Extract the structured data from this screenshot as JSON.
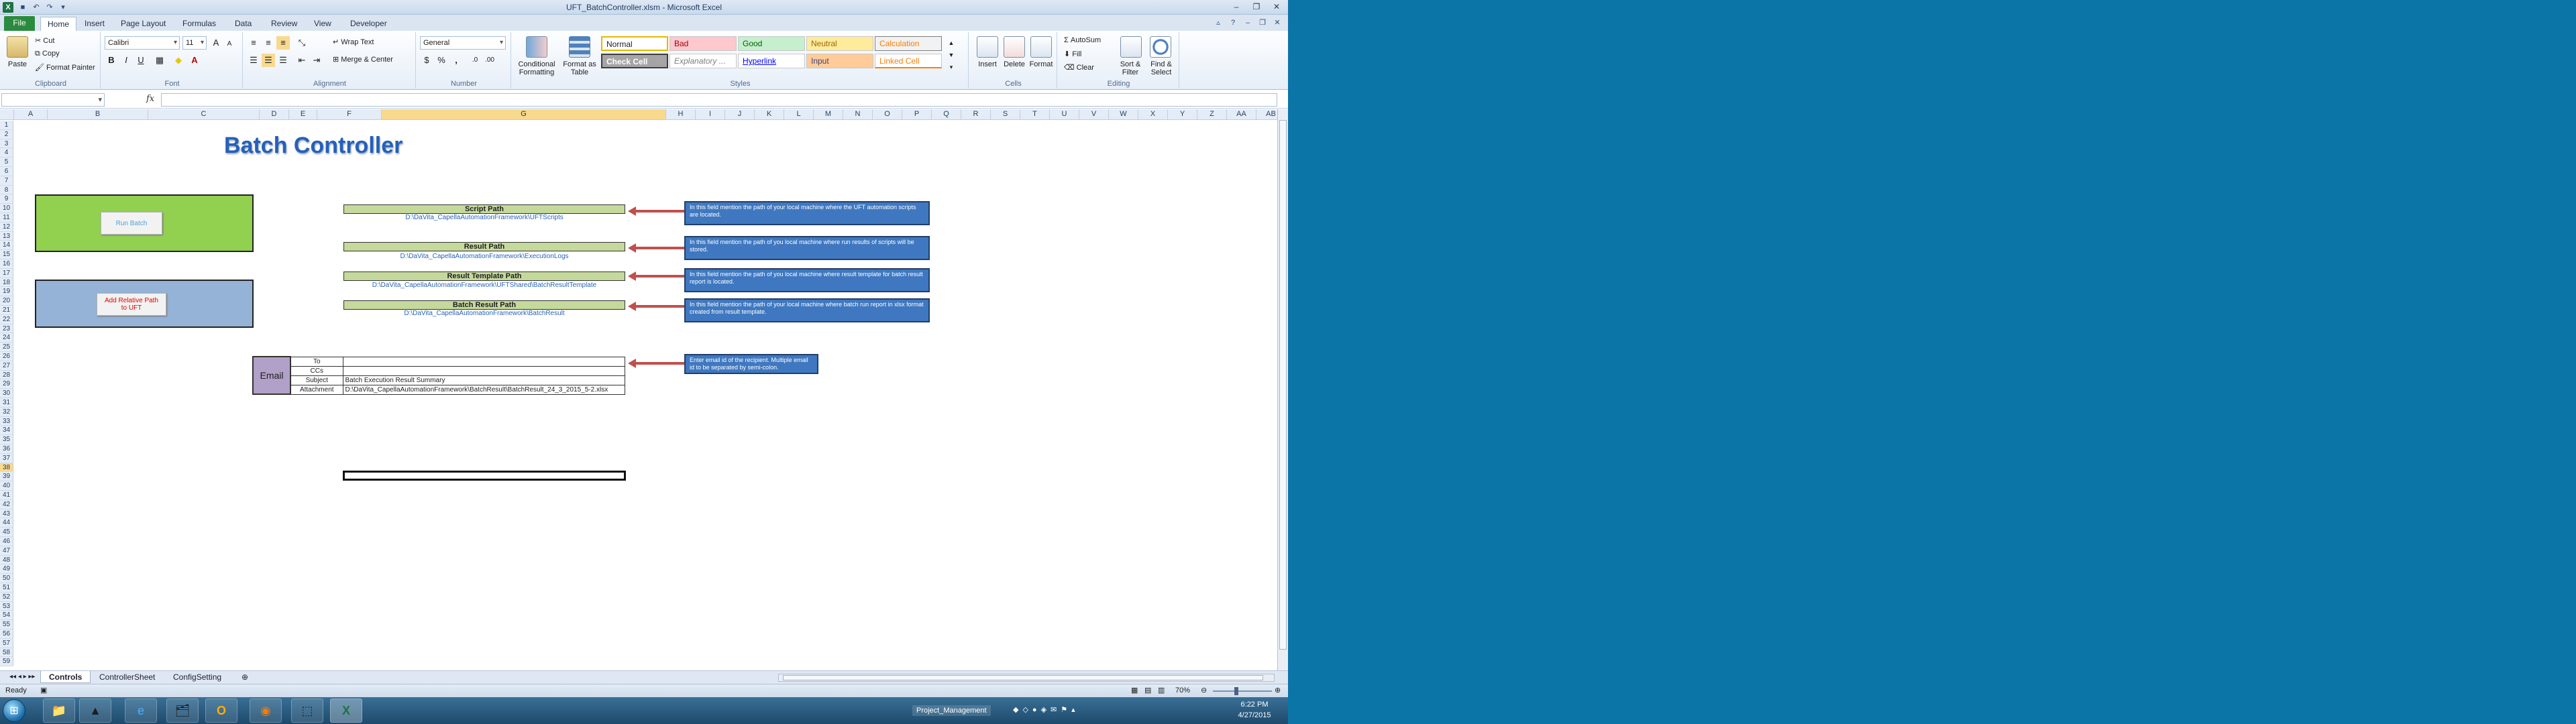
{
  "window": {
    "title": "UFT_BatchController.xlsm - Microsoft Excel"
  },
  "tabs": [
    "File",
    "Home",
    "Insert",
    "Page Layout",
    "Formulas",
    "Data",
    "Review",
    "View",
    "Developer"
  ],
  "ribbon": {
    "clipboard": {
      "name": "Clipboard",
      "paste": "Paste",
      "cut": "Cut",
      "copy": "Copy",
      "format_painter": "Format Painter"
    },
    "font": {
      "name": "Font",
      "family": "Calibri",
      "size": "11",
      "bold": "B",
      "italic": "I",
      "underline": "U"
    },
    "alignment": {
      "name": "Alignment",
      "wrap_text": "Wrap Text",
      "merge_center": "Merge & Center"
    },
    "number": {
      "name": "Number",
      "format": "General",
      "currency": "$",
      "percent": "%",
      "comma": ","
    },
    "styles": {
      "name": "Styles",
      "conditional_formatting": "Conditional Formatting",
      "format_as_table": "Format as Table",
      "cells": [
        "Normal",
        "Bad",
        "Good",
        "Neutral",
        "Calculation",
        "Check Cell",
        "Explanatory ...",
        "Hyperlink",
        "Input",
        "Linked Cell"
      ]
    },
    "cells": {
      "name": "Cells",
      "insert": "Insert",
      "delete": "Delete",
      "format": "Format"
    },
    "editing": {
      "name": "Editing",
      "autosum": "AutoSum",
      "fill": "Fill",
      "clear": "Clear",
      "sort_filter": "Sort & Filter",
      "find_select": "Find & Select"
    }
  },
  "formula_bar": {
    "namebox": "",
    "fx": "fx",
    "content": ""
  },
  "columns": [
    "A",
    "B",
    "C",
    "D",
    "E",
    "F",
    "G",
    "H",
    "I",
    "J",
    "K",
    "L",
    "M",
    "N",
    "O",
    "P",
    "Q",
    "R",
    "S",
    "T",
    "U",
    "V",
    "W",
    "X",
    "Y",
    "Z",
    "AA",
    "AB",
    "AC"
  ],
  "selected_column": "G",
  "selected_row": "38",
  "sheet": {
    "title": "Batch Controller",
    "run_batch": "Run Batch",
    "add_relative_path": "Add Relative Path to UFT",
    "paths": [
      {
        "label": "Script Path",
        "value": "D:\\DaVita_CapellaAutomationFramework\\UFTScripts",
        "note": "In this field mention the path of your local machine where the UFT automation scripts are located."
      },
      {
        "label": "Result Path",
        "value": "D:\\DaVita_CapellaAutomationFramework\\ExecutionLogs",
        "note": "In this field mention the path of you local machine where run results of scripts will be stored."
      },
      {
        "label": "Result Template Path",
        "value": "D:\\DaVita_CapellaAutomationFramework\\UFTShared\\BatchResultTemplate",
        "note": "In this field mention the path of you local machine where result template for batch result report is located."
      },
      {
        "label": "Batch Result Path",
        "value": "D:\\DaVita_CapellaAutomationFramework\\BatchResult",
        "note": "In this field mention the path of your local machine where batch run report in xlsx format created from result template."
      }
    ],
    "email": {
      "label": "Email",
      "rows": [
        {
          "field": "To",
          "value": ""
        },
        {
          "field": "CCs",
          "value": ""
        },
        {
          "field": "Subject",
          "value": "Batch Execution Result Summary"
        },
        {
          "field": "Attachment",
          "value": "D:\\DaVita_CapellaAutomationFramework\\BatchResult\\BatchResult_24_3_2015_5-2.xlsx"
        }
      ],
      "note": "Enter email id of the recipient. Multiple email id to be separated by semi-colon."
    }
  },
  "sheet_tabs": [
    "Controls",
    "ControllerSheet",
    "ConfigSetting"
  ],
  "status": {
    "ready": "Ready",
    "zoom": "70%"
  },
  "taskbar": {
    "folder_label": "Project_Management",
    "time": "6:22 PM",
    "date": "4/27/2015"
  }
}
